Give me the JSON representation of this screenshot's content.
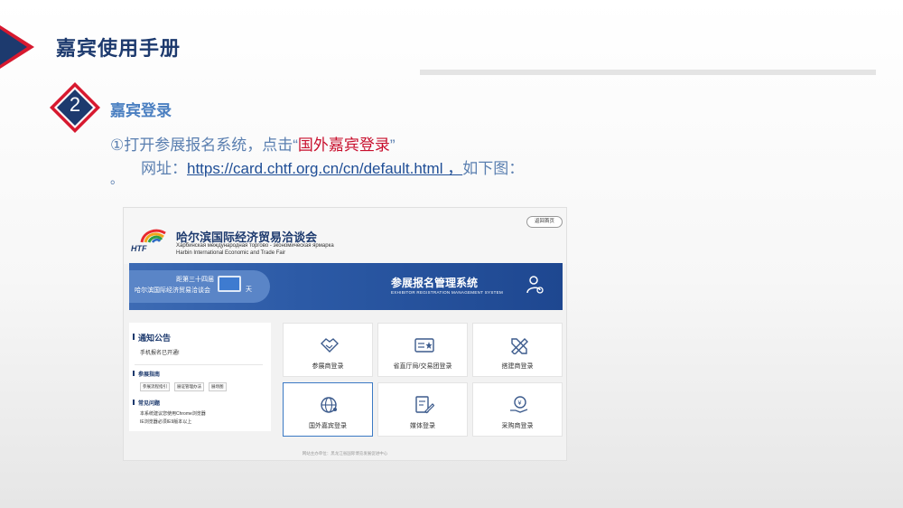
{
  "slide": {
    "title": "嘉宾使用手册",
    "step_number": "2",
    "section_heading": "嘉宾登录",
    "instruction_prefix": "①打开参展报名系统，点击“",
    "instruction_highlight": "国外嘉宾登录",
    "instruction_suffix": "”",
    "url_prefix": "网址：",
    "url": "https://card.chtf.org.cn/cn/default.html ，",
    "url_suffix": "如下图：",
    "trailing_mark": "。"
  },
  "screenshot": {
    "header": {
      "logo_text": "HTF",
      "site_name_cn": "哈尔滨国际经济贸易洽谈会",
      "site_name_ru": "Харбинская международная торгово - экономическая ярмарка",
      "site_name_en": "Harbin International Economic and Trade Fair",
      "return_label": "返回首页"
    },
    "banner": {
      "countdown_line1": "距第三十四届",
      "countdown_line2": "哈尔滨国际经济贸易洽谈会",
      "countdown_unit": "天",
      "title": "参展报名管理系统",
      "subtitle": "EXHIBITOR REGISTRATION MANAGEMENT SYSTEM"
    },
    "notice": {
      "heading": "通知公告",
      "text": "手机报名已开通!",
      "guide_heading": "参展指南",
      "tags": [
        "参展流程指引",
        "展证管理办法",
        "展场图"
      ],
      "faq_heading": "常见问题",
      "faq_line1": "本系统建议您使用Chrome浏览器",
      "faq_line2": "IE浏览器必须IE9版本以上"
    },
    "tiles": [
      {
        "label": "参展商登录",
        "icon": "handshake-icon"
      },
      {
        "label": "省直厅局/交易团登录",
        "icon": "id-card-icon"
      },
      {
        "label": "搭建商登录",
        "icon": "tools-icon"
      },
      {
        "label": "国外嘉宾登录",
        "icon": "globe-user-icon"
      },
      {
        "label": "媒体登录",
        "icon": "document-pen-icon"
      },
      {
        "label": "采购商登录",
        "icon": "money-hand-icon"
      }
    ],
    "footer": "网站主办单位：黑龙江省国际博览发展促进中心"
  },
  "colors": {
    "title": "#1d3a6e",
    "accent_blue": "#4a7fc1",
    "highlight_red": "#c8102e",
    "banner_blue": "#2c5aa6",
    "corner_red": "#d7192f"
  }
}
